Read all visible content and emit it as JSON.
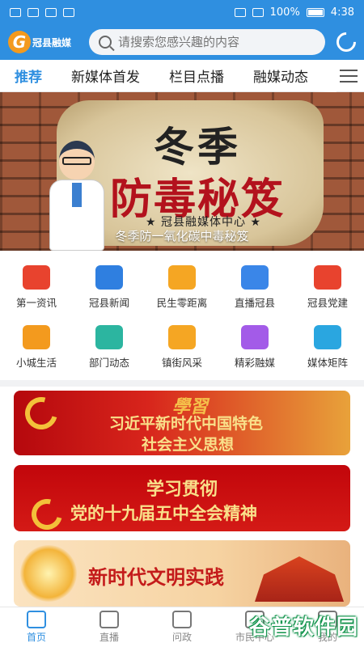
{
  "status_bar": {
    "battery": "100%",
    "time": "4:38"
  },
  "header": {
    "logo_text": "冠县融媒",
    "search_placeholder": "请搜索您感兴趣的内容"
  },
  "tabs": [
    "推荐",
    "新媒体首发",
    "栏目点播",
    "融媒动态"
  ],
  "banner": {
    "title_line1": "冬季",
    "title_line2": "防毒秘笈",
    "org": "★ 冠县融媒体中心 ★",
    "caption": "冬季防一氧化碳中毒秘笈"
  },
  "grid": [
    {
      "label": "第一资讯",
      "icon": "news-icon",
      "color": "#e8432e"
    },
    {
      "label": "冠县新闻",
      "icon": "newspaper-icon",
      "color": "#2f7fe0"
    },
    {
      "label": "民生零距离",
      "icon": "flower-icon",
      "color": "#f5a623"
    },
    {
      "label": "直播冠县",
      "icon": "tv-icon",
      "color": "#3a86e8"
    },
    {
      "label": "冠县党建",
      "icon": "party-emblem-icon",
      "color": "#e8432e"
    },
    {
      "label": "小城生活",
      "icon": "coffee-cup-icon",
      "color": "#f39a1e"
    },
    {
      "label": "部门动态",
      "icon": "building-icon",
      "color": "#2cb5a0"
    },
    {
      "label": "镇街风采",
      "icon": "house-icon",
      "color": "#f5a623"
    },
    {
      "label": "精彩融媒",
      "icon": "tv-badge-icon",
      "color": "#a35be8"
    },
    {
      "label": "媒体矩阵",
      "icon": "grid-icon",
      "color": "#2aa6e0"
    }
  ],
  "promos": {
    "p1": {
      "script": "學習",
      "line1": "习近平新时代中国特色",
      "line2": "社会主义思想"
    },
    "p2": {
      "line1": "学习贯彻",
      "line2": "党的十九届五中全会精神"
    },
    "p3": {
      "line1": "新时代文明实践"
    }
  },
  "bottom_nav": [
    {
      "label": "首页",
      "icon": "home-icon",
      "active": true
    },
    {
      "label": "直播",
      "icon": "video-camera-icon",
      "active": false
    },
    {
      "label": "问政",
      "icon": "question-icon",
      "active": false
    },
    {
      "label": "市民中心",
      "icon": "user-center-icon",
      "active": false
    },
    {
      "label": "我的",
      "icon": "profile-icon",
      "active": false
    }
  ],
  "watermark": "谷普软件园"
}
